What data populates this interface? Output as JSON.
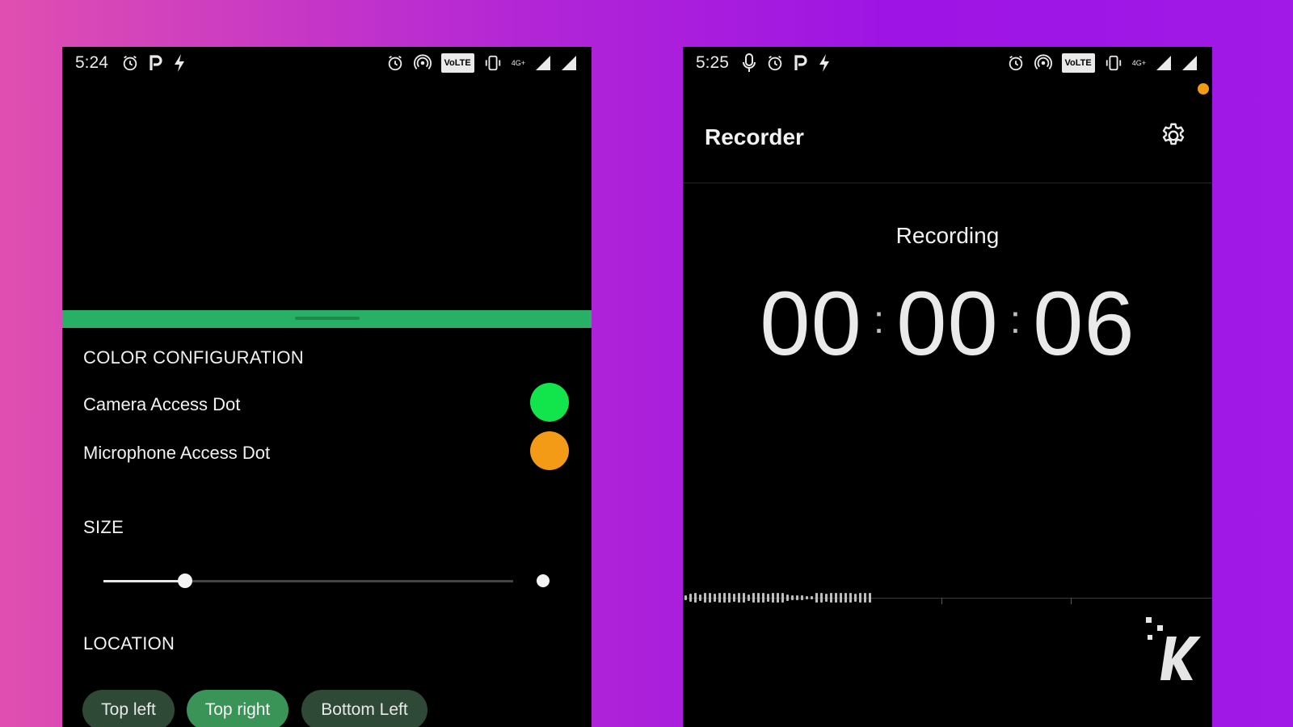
{
  "left_phone": {
    "statusbar": {
      "time": "5:24",
      "volte_label": "VoLTE",
      "network_label": "4G+"
    },
    "color_section": {
      "title": "COLOR CONFIGURATION",
      "items": [
        {
          "label": "Camera Access Dot",
          "color": "#12e54c"
        },
        {
          "label": "Microphone Access Dot",
          "color": "#f39a17"
        }
      ]
    },
    "size_section": {
      "title": "SIZE",
      "slider_fraction": 0.2
    },
    "location_section": {
      "title": "LOCATION",
      "chips": [
        {
          "label": "Top left",
          "active": false
        },
        {
          "label": "Top right",
          "active": true
        },
        {
          "label": "Bottom Left",
          "active": false
        }
      ]
    },
    "accent_color": "#27b066"
  },
  "right_phone": {
    "statusbar": {
      "time": "5:25",
      "volte_label": "VoLTE",
      "network_label": "4G+"
    },
    "app_title": "Recorder",
    "status_text": "Recording",
    "timer": {
      "hours": "00",
      "minutes": "00",
      "seconds": "06"
    },
    "privacy_dot_color": "#f39a17",
    "watermark_icon": "knowtechie-k-logo"
  }
}
